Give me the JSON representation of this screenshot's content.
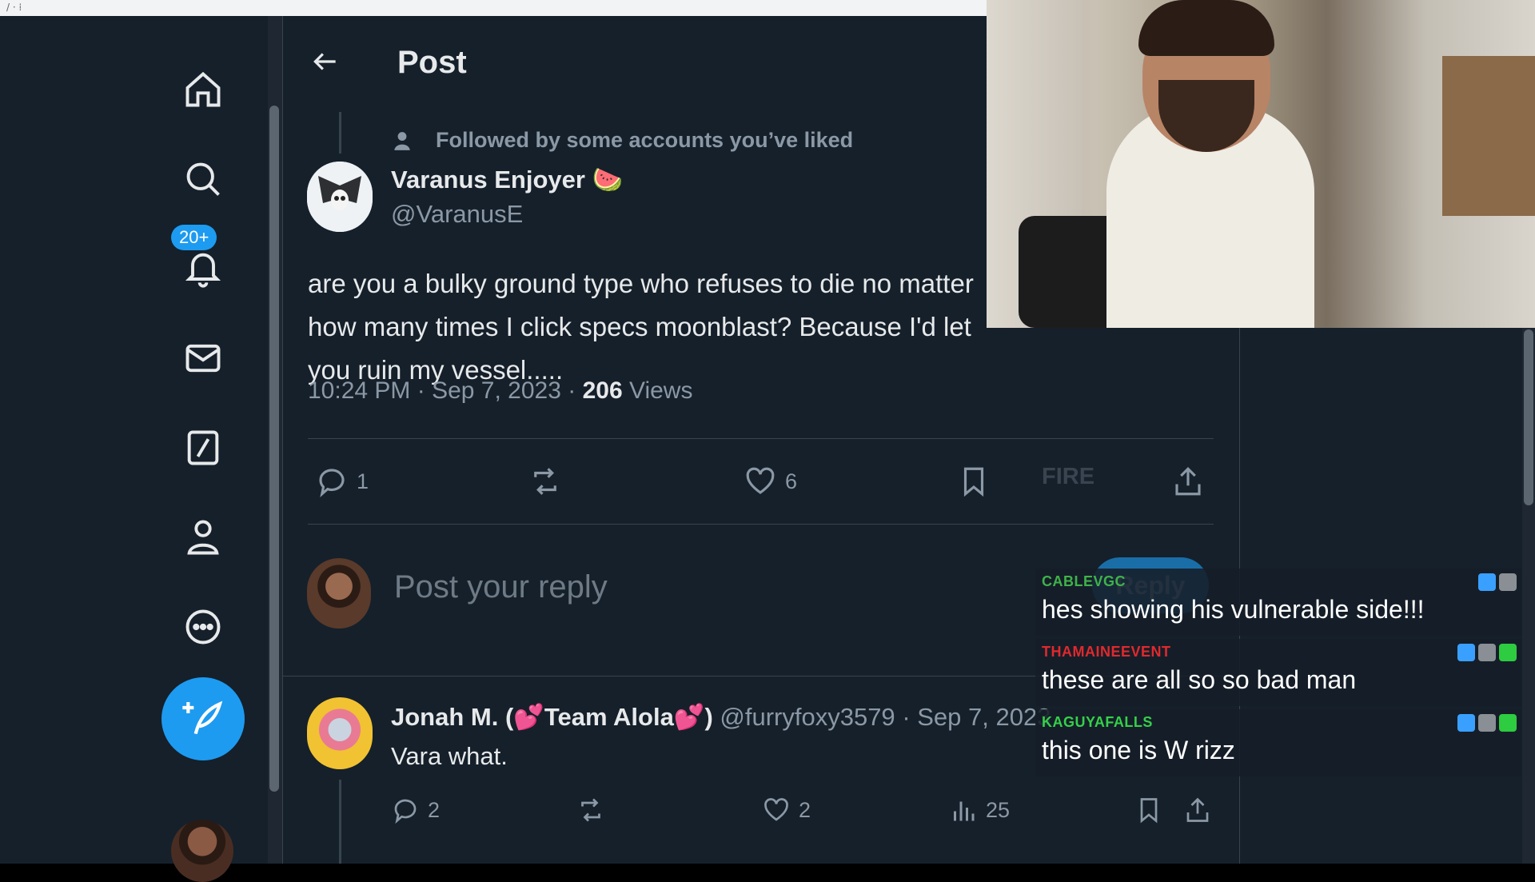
{
  "browser": {
    "top_fragment": "/ · ⁞"
  },
  "nav": {
    "notifications_badge": "20+",
    "items": [
      "home",
      "explore",
      "notifications",
      "messages",
      "grok",
      "profile",
      "more"
    ]
  },
  "header": {
    "title": "Post"
  },
  "post": {
    "social_context": "Followed by some accounts you’ve liked",
    "author_name": "Varanus Enjoyer 🍉",
    "author_handle": "@VaranusE",
    "text": "are you a bulky ground type who refuses to die no matter how many times I click specs moonblast? Because I'd let you ruin my vessel.....",
    "time": "10:24 PM",
    "date": "Sep 7, 2023",
    "views_count": "206",
    "views_label": "Views",
    "replies": "1",
    "likes": "6"
  },
  "reply_box": {
    "placeholder": "Post your reply",
    "button": "Reply"
  },
  "reply": {
    "name_prefix": "Jonah M. (",
    "heart": "💕",
    "team": "Team Alola",
    "name_suffix": ")",
    "handle": "@furryfoxy3579",
    "date": "Sep 7, 2023",
    "text": "Vara what.",
    "replies": "2",
    "likes": "2",
    "views": "25"
  },
  "overlay": {
    "fire_text": "FIRE",
    "chat": [
      {
        "user": "CABLEVGC",
        "color": "#3fb24a",
        "text": "hes showing his vulnerable side!!!"
      },
      {
        "user": "THAMAINEEVENT",
        "color": "#e0292e",
        "text": "these are all so so bad man"
      },
      {
        "user": "KAGUYAFALLS",
        "color": "#35d04a",
        "text": "this one is W rizz"
      }
    ]
  },
  "colors": {
    "accent": "#1d9bf0",
    "background": "#15202b",
    "secondary_text": "#8b98a5"
  }
}
